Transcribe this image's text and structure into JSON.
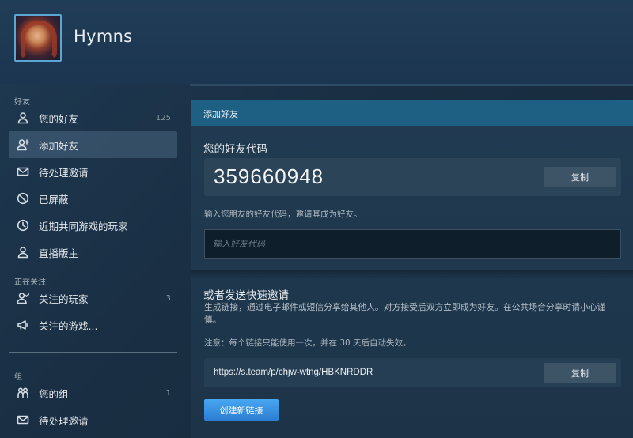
{
  "profile": {
    "name": "Hymns"
  },
  "sidebar": {
    "sections": [
      {
        "label": "好友"
      },
      {
        "label": "正在关注"
      },
      {
        "label": "组"
      }
    ],
    "items": [
      {
        "label": "您的好友",
        "count": "125",
        "icon": "user-icon"
      },
      {
        "label": "添加好友",
        "count": "",
        "icon": "user-plus-icon",
        "active": true
      },
      {
        "label": "待处理邀请",
        "count": "",
        "icon": "envelope-icon"
      },
      {
        "label": "已屏蔽",
        "count": "",
        "icon": "block-icon"
      },
      {
        "label": "近期共同游戏的玩家",
        "count": "",
        "icon": "clock-icon"
      },
      {
        "label": "直播版主",
        "count": "",
        "icon": "user-icon"
      },
      {
        "label": "关注的玩家",
        "count": "3",
        "icon": "user-follow-icon"
      },
      {
        "label": "关注的游戏...",
        "count": "",
        "icon": "megaphone-icon"
      },
      {
        "label": "您的组",
        "count": "1",
        "icon": "group-icon"
      },
      {
        "label": "待处理邀请",
        "count": "",
        "icon": "envelope-icon"
      }
    ]
  },
  "panel": {
    "title": "添加好友",
    "friend_code": {
      "heading": "您的好友代码",
      "value": "359660948",
      "copy_label": "复制",
      "hint": "输入您朋友的好友代码，邀请其成为好友。",
      "input_placeholder": "输入好友代码"
    },
    "quick_invite": {
      "heading": "或者发送快速邀请",
      "description": "生成链接，通过电子邮件或短信分享给其他人。对方接受后双方立即成为好友。在公共场合分享时请小心谨慎。",
      "note": "注意：每个链接只能使用一次，并在 30 天后自动失效。",
      "link": "https://s.team/p/chjw-wtng/HBKNRDDR",
      "copy_label": "复制",
      "create_label": "创建新链接"
    }
  },
  "colors": {
    "accent_header": "#1e5f84",
    "button_primary": "#2d7dd2",
    "button_secondary": "#3d5366"
  }
}
